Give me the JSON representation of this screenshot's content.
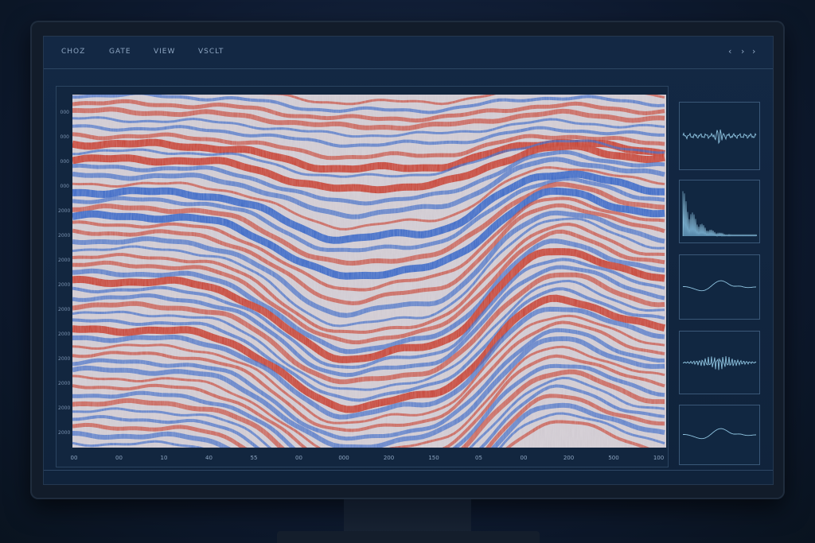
{
  "menu": {
    "items": [
      {
        "label": "CHOZ"
      },
      {
        "label": "GATE"
      },
      {
        "label": "VIEW"
      },
      {
        "label": "VSCLT"
      }
    ]
  },
  "nav": {
    "left_glyph": "‹",
    "mid_glyph": "›",
    "right_glyph": "›"
  },
  "colors": {
    "positive": "#c43a2a",
    "negative": "#2f61c4",
    "neutral": "#d8d2d6",
    "panel_line": "#8fc4e0"
  },
  "seismic_axis": {
    "y_ticks": [
      "000",
      "000",
      "000",
      "000",
      "2000",
      "2000",
      "2000",
      "2000",
      "2000",
      "2000",
      "2000",
      "2000",
      "2000",
      "2000"
    ],
    "x_ticks": [
      "00",
      "00",
      "10",
      "40",
      "55",
      "00",
      "000",
      "200",
      "150",
      "05",
      "00",
      "200",
      "500",
      "100"
    ]
  },
  "side_panels": [
    {
      "type": "wavelet-icon"
    },
    {
      "type": "spectrum-icon"
    },
    {
      "type": "smooth-wave-icon"
    },
    {
      "type": "noise-trace-icon"
    },
    {
      "type": "smooth-wave-icon"
    }
  ]
}
